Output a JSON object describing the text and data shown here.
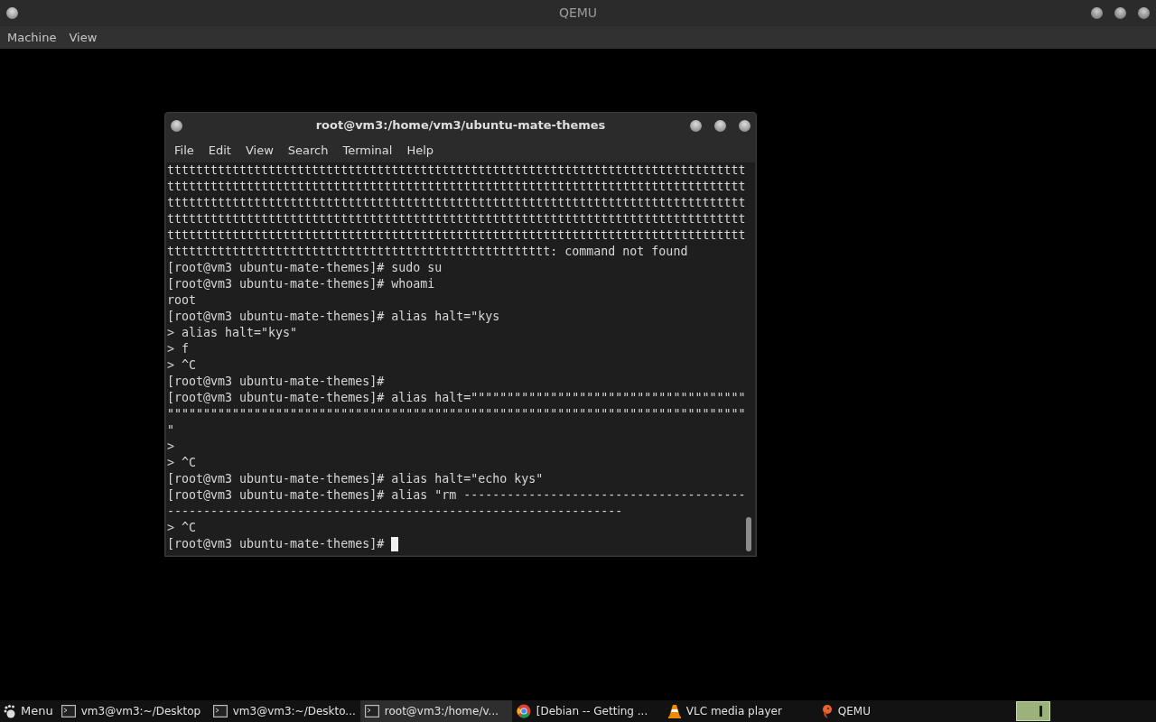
{
  "qemu_window": {
    "title": "QEMU",
    "menu": [
      "Machine",
      "View"
    ]
  },
  "terminal": {
    "title": "root@vm3:/home/vm3/ubuntu-mate-themes",
    "menu": [
      "File",
      "Edit",
      "View",
      "Search",
      "Terminal",
      "Help"
    ],
    "lines": [
      "tttttttttttttttttttttttttttttttttttttttttttttttttttttttttttttttttttttttttttttttt",
      "tttttttttttttttttttttttttttttttttttttttttttttttttttttttttttttttttttttttttttttttt",
      "tttttttttttttttttttttttttttttttttttttttttttttttttttttttttttttttttttttttttttttttt",
      "tttttttttttttttttttttttttttttttttttttttttttttttttttttttttttttttttttttttttttttttt",
      "tttttttttttttttttttttttttttttttttttttttttttttttttttttttttttttttttttttttttttttttt",
      "ttttttttttttttttttttttttttttttttttttttttttttttttttttt: command not found",
      "[root@vm3 ubuntu-mate-themes]# sudo su",
      "[root@vm3 ubuntu-mate-themes]# whoami",
      "root",
      "[root@vm3 ubuntu-mate-themes]# alias halt=\"kys",
      "> alias halt=\"kys\"",
      "> f",
      "> ^C",
      "[root@vm3 ubuntu-mate-themes]#",
      "[root@vm3 ubuntu-mate-themes]# alias halt=\"\"\"\"\"\"\"\"\"\"\"\"\"\"\"\"\"\"\"\"\"\"\"\"\"\"\"\"\"\"\"\"\"\"\"\"\"\"",
      "\"\"\"\"\"\"\"\"\"\"\"\"\"\"\"\"\"\"\"\"\"\"\"\"\"\"\"\"\"\"\"\"\"\"\"\"\"\"\"\"\"\"\"\"\"\"\"\"\"\"\"\"\"\"\"\"\"\"\"\"\"\"\"\"\"\"\"\"\"\"\"\"\"\"\"\"\"\"\"\"",
      "\"",
      ">",
      "> ^C",
      "[root@vm3 ubuntu-mate-themes]# alias halt=\"echo kys\"",
      "[root@vm3 ubuntu-mate-themes]# alias \"rm ---------------------------------------",
      "---------------------------------------------------------------",
      "> ^C",
      "[root@vm3 ubuntu-mate-themes]# "
    ]
  },
  "taskbar": {
    "menu_label": "Menu",
    "tasks": [
      {
        "kind": "terminal",
        "label": "vm3@vm3:~/Desktop",
        "selected": false
      },
      {
        "kind": "terminal",
        "label": "vm3@vm3:~/Deskto...",
        "selected": false
      },
      {
        "kind": "terminal",
        "label": "root@vm3:/home/v...",
        "selected": true
      },
      {
        "kind": "browser",
        "label": "[Debian -- Getting ...",
        "selected": false
      },
      {
        "kind": "vlc",
        "label": "VLC media player",
        "selected": false
      },
      {
        "kind": "qemu",
        "label": "QEMU",
        "selected": false
      }
    ]
  }
}
